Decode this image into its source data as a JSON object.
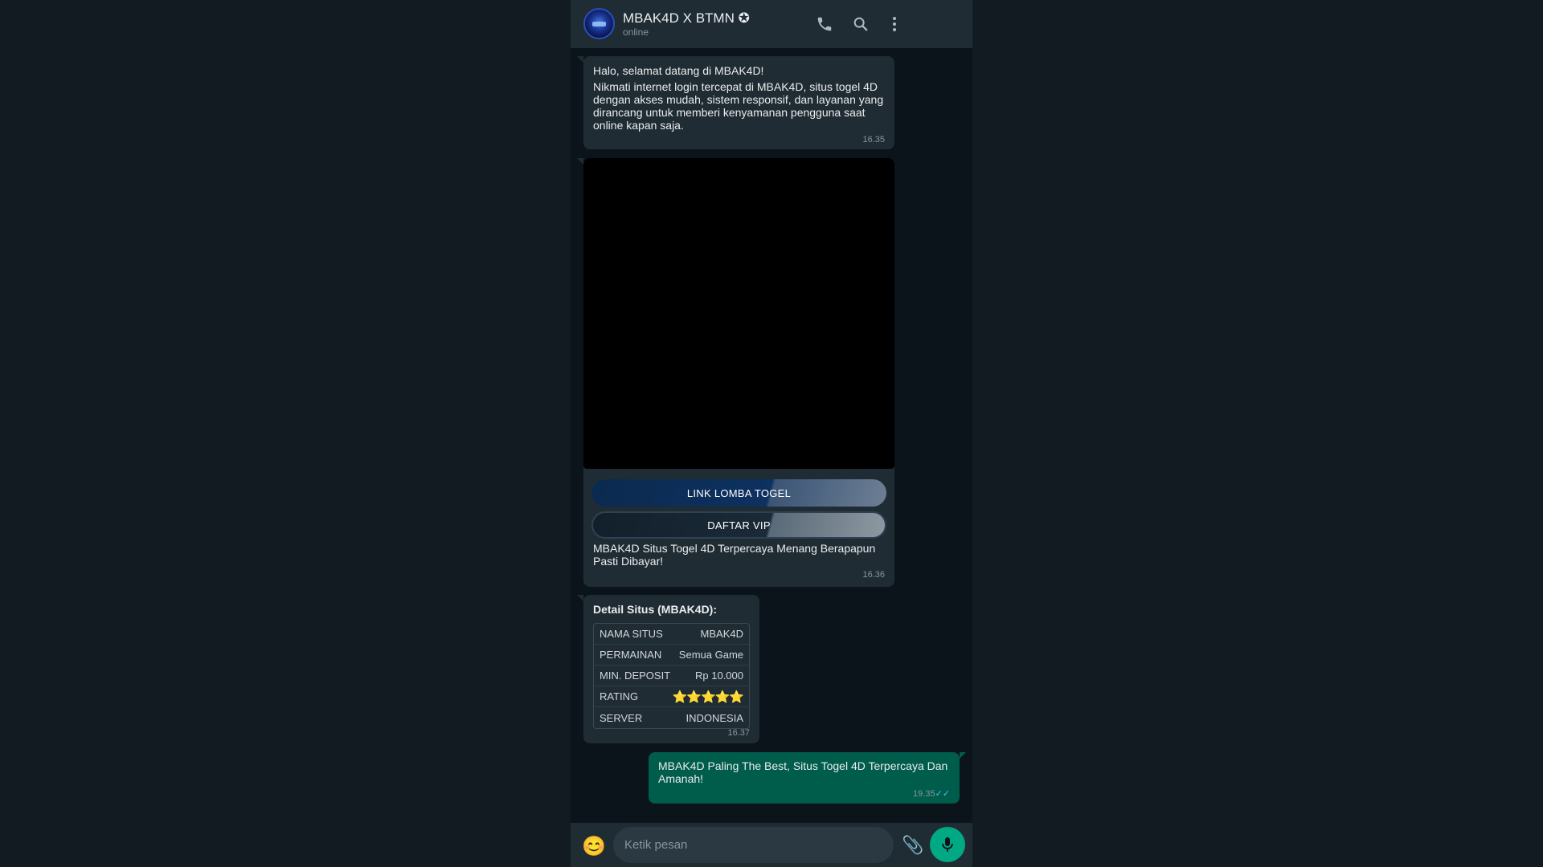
{
  "header": {
    "title": "MBAK4D X BTMN ✪",
    "status": "online",
    "icons": [
      "phone-icon",
      "search-icon",
      "more-icon"
    ]
  },
  "messages": [
    {
      "greeting": "Halo, selamat datang di MBAK4D!",
      "body": "Nikmati internet login tercepat di MBAK4D, situs togel 4D dengan akses mudah, sistem responsif, dan layanan yang dirancang untuk memberi kenyamanan pengguna saat online kapan saja.",
      "time": "16.35"
    },
    {
      "buttons": [
        "LINK LOMBA TOGEL",
        "DAFTAR VIP"
      ],
      "caption": "MBAK4D Situs Togel 4D Terpercaya Menang Berapapun Pasti Dibayar!",
      "time": "16.36"
    },
    {
      "heading": "Detail Situs (MBAK4D):",
      "rows": [
        {
          "label": "NAMA SITUS",
          "value": "MBAK4D"
        },
        {
          "label": "PERMAINAN",
          "value": "Semua Game"
        },
        {
          "label": "MIN. DEPOSIT",
          "value": "Rp 10.000"
        },
        {
          "label": "RATING",
          "value": "⭐⭐⭐⭐⭐"
        },
        {
          "label": "SERVER",
          "value": "INDONESIA"
        }
      ],
      "time": "16.37"
    },
    {
      "text": "MBAK4D Paling The Best, Situs Togel 4D Terpercaya Dan Amanah!",
      "time": "19.35",
      "ticks": "✓✓"
    }
  ],
  "footer": {
    "placeholder": "Ketik pesan"
  },
  "colors": {
    "header_bg": "#1f2c34",
    "incoming_bg": "#202c33",
    "outgoing_bg": "#005c4b",
    "accent": "#00a884"
  }
}
